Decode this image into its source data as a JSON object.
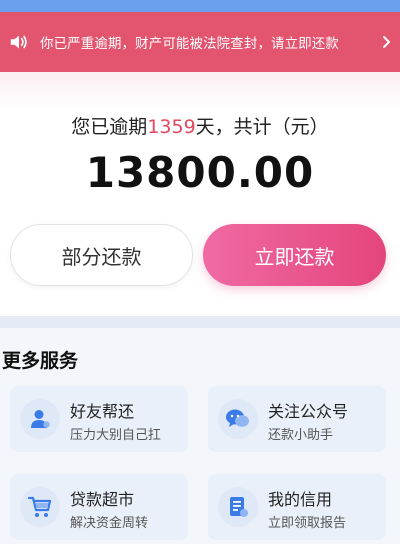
{
  "alert": {
    "text": "你已严重逾期，财产可能被法院查封，请立即还款",
    "icon": "speaker-icon",
    "chevron": "chevron-right-icon"
  },
  "debt": {
    "prefix": "您已逾期",
    "days": "1359",
    "suffix": "天，共计（元）",
    "amount": "13800.00"
  },
  "actions": {
    "partial_label": "部分还款",
    "repay_now_label": "立即还款"
  },
  "services": {
    "title": "更多服务",
    "items": [
      {
        "title": "好友帮还",
        "subtitle": "压力大别自己扛",
        "icon": "user-icon"
      },
      {
        "title": "关注公众号",
        "subtitle": "还款小助手",
        "icon": "chat-icon"
      },
      {
        "title": "贷款超市",
        "subtitle": "解决资金周转",
        "icon": "cart-icon"
      },
      {
        "title": "我的信用",
        "subtitle": "立即领取报告",
        "icon": "credit-report-icon"
      }
    ]
  },
  "colors": {
    "alert_bg": "#e3546f",
    "accent_pink": "#e4457c",
    "days_highlight": "#e2475f",
    "icon_blue": "#3b7be8"
  }
}
